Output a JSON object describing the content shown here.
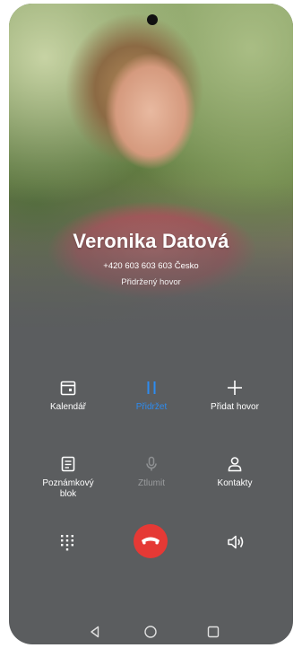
{
  "status_bar": {
    "left_text": "",
    "right_text": ""
  },
  "caller": {
    "name": "Veronika Datová",
    "number_line": "+420 603 603 603  Česko",
    "call_state": "Přidržený hovor"
  },
  "actions": {
    "calendar": {
      "label": "Kalendář",
      "icon": "calendar-icon"
    },
    "hold": {
      "label": "Přidržet",
      "icon": "pause-icon",
      "color": "#2d8cf0"
    },
    "add_call": {
      "label": "Přidat hovor",
      "icon": "plus-icon"
    },
    "notepad": {
      "label": "Poznámkový\nblok",
      "label_lines": [
        "Poznámkový",
        "blok"
      ],
      "icon": "notepad-icon"
    },
    "mute": {
      "label": "Ztlumit",
      "icon": "microphone-icon",
      "disabled": true
    },
    "contacts": {
      "label": "Kontakty",
      "icon": "person-icon"
    }
  },
  "bottom_controls": {
    "keypad": {
      "icon": "dialpad-icon"
    },
    "end_call": {
      "icon": "hang-up-icon",
      "color": "#e53935"
    },
    "speaker": {
      "icon": "speaker-icon"
    }
  },
  "navigation": {
    "back": "back-icon",
    "home": "home-icon",
    "recents": "recents-icon"
  }
}
